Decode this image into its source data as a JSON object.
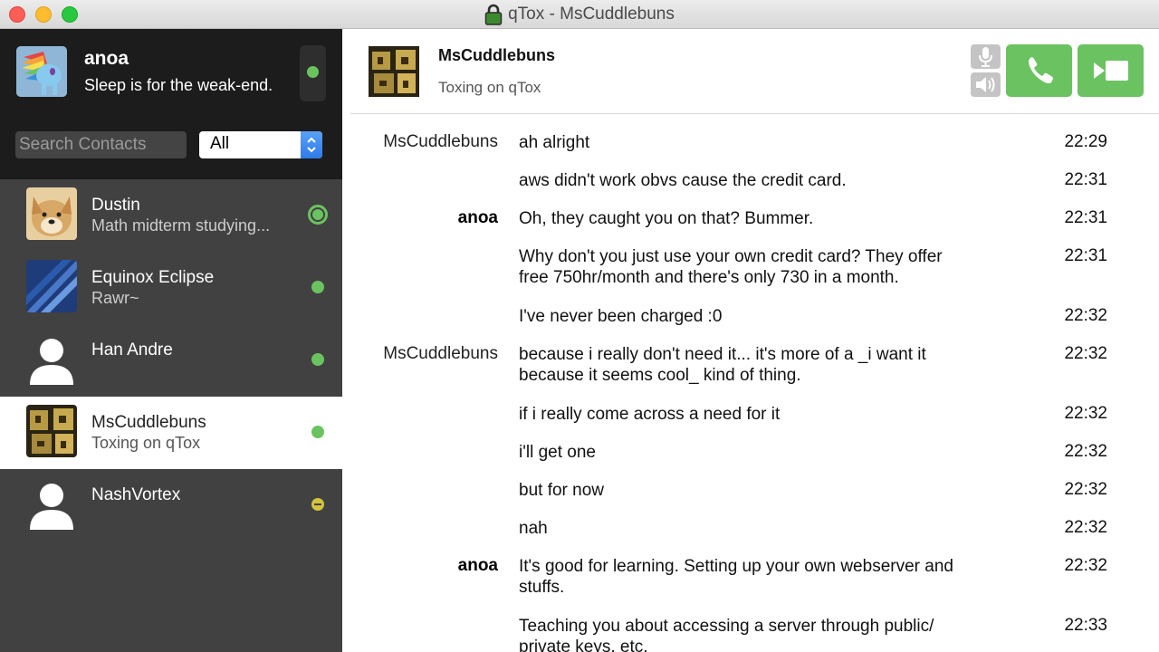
{
  "window": {
    "title": "qTox - MsCuddlebuns"
  },
  "profile": {
    "name": "anoa",
    "status_message": "Sleep is for the weak-end.",
    "status": "online"
  },
  "search": {
    "placeholder": "Search Contacts",
    "value": ""
  },
  "filter": {
    "selected": "All"
  },
  "contacts": [
    {
      "name": "Dustin",
      "status_message": "Math midterm studying...",
      "status": "online-active"
    },
    {
      "name": "Equinox Eclipse",
      "status_message": "Rawr~",
      "status": "online"
    },
    {
      "name": "Han Andre",
      "status_message": "",
      "status": "online"
    },
    {
      "name": "MsCuddlebuns",
      "status_message": "Toxing on qTox",
      "status": "online",
      "selected": true
    },
    {
      "name": "NashVortex",
      "status_message": "",
      "status": "away"
    }
  ],
  "chat": {
    "friend_name": "MsCuddlebuns",
    "friend_status": "Toxing on qTox",
    "messages": [
      {
        "sender": "MsCuddlebuns",
        "text": "ah alright",
        "time": "22:29"
      },
      {
        "sender": "",
        "text": "aws didn't work obvs cause the credit card.",
        "time": "22:31"
      },
      {
        "sender": "anoa",
        "text": "Oh, they caught you on that? Bummer.",
        "time": "22:31"
      },
      {
        "sender": "",
        "text": "Why don't you just use your own credit card? They offer free 750hr/month and there's only 730 in a month.",
        "time": "22:31"
      },
      {
        "sender": "",
        "text": "I've never been charged :0",
        "time": "22:32"
      },
      {
        "sender": "MsCuddlebuns",
        "text": "because i really don't need it... it's more of a _i want it because it seems cool_ kind of thing.",
        "time": "22:32"
      },
      {
        "sender": "",
        "text": "if i really come across a need for it",
        "time": "22:32"
      },
      {
        "sender": "",
        "text": "i'll get one",
        "time": "22:32"
      },
      {
        "sender": "",
        "text": "but for now",
        "time": "22:32"
      },
      {
        "sender": "",
        "text": "nah",
        "time": "22:32"
      },
      {
        "sender": "anoa",
        "text": "It's good for learning. Setting up your own webserver and stuffs.",
        "time": "22:32"
      },
      {
        "sender": "",
        "text": "Teaching you about accessing a server through public/ private keys, etc.",
        "time": "22:33"
      }
    ]
  },
  "colors": {
    "sidebar_bg": "#414141",
    "profile_bg": "#1c1c1c",
    "online": "#6bc260",
    "away": "#d3c33d",
    "call_button": "#6bc260"
  },
  "icons": {
    "lock": "lock-icon",
    "mic": "microphone-icon",
    "volume": "speaker-icon",
    "call": "phone-icon",
    "video": "video-camera-icon"
  }
}
